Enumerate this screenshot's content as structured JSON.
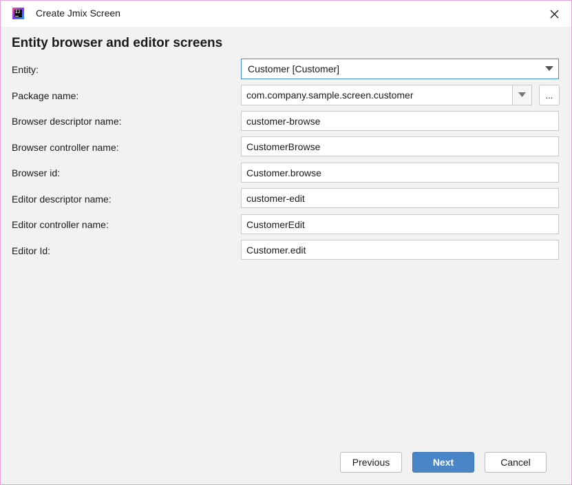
{
  "window": {
    "title": "Create Jmix Screen",
    "app_icon_text": "IJ"
  },
  "heading": "Entity browser and editor screens",
  "form": {
    "entity": {
      "label": "Entity:",
      "value": "Customer [Customer]"
    },
    "package": {
      "label": "Package name:",
      "value": "com.company.sample.screen.customer",
      "browse_label": "..."
    },
    "browser_descriptor": {
      "label": "Browser descriptor name:",
      "value": "customer-browse"
    },
    "browser_controller": {
      "label": "Browser controller name:",
      "value": "CustomerBrowse"
    },
    "browser_id": {
      "label": "Browser id:",
      "value": "Customer.browse"
    },
    "editor_descriptor": {
      "label": "Editor descriptor name:",
      "value": "customer-edit"
    },
    "editor_controller": {
      "label": "Editor controller name:",
      "value": "CustomerEdit"
    },
    "editor_id": {
      "label": "Editor Id:",
      "value": "Customer.edit"
    }
  },
  "buttons": {
    "previous": "Previous",
    "next": "Next",
    "cancel": "Cancel"
  },
  "icons": {
    "close": "close-icon",
    "dropdown": "chevron-down-icon",
    "app": "intellij-idea-icon"
  },
  "colors": {
    "accent": "#4a86c7",
    "focus_border": "#3d8ee0",
    "background": "#f2f2f2",
    "window_border": "#e5a3d8"
  }
}
